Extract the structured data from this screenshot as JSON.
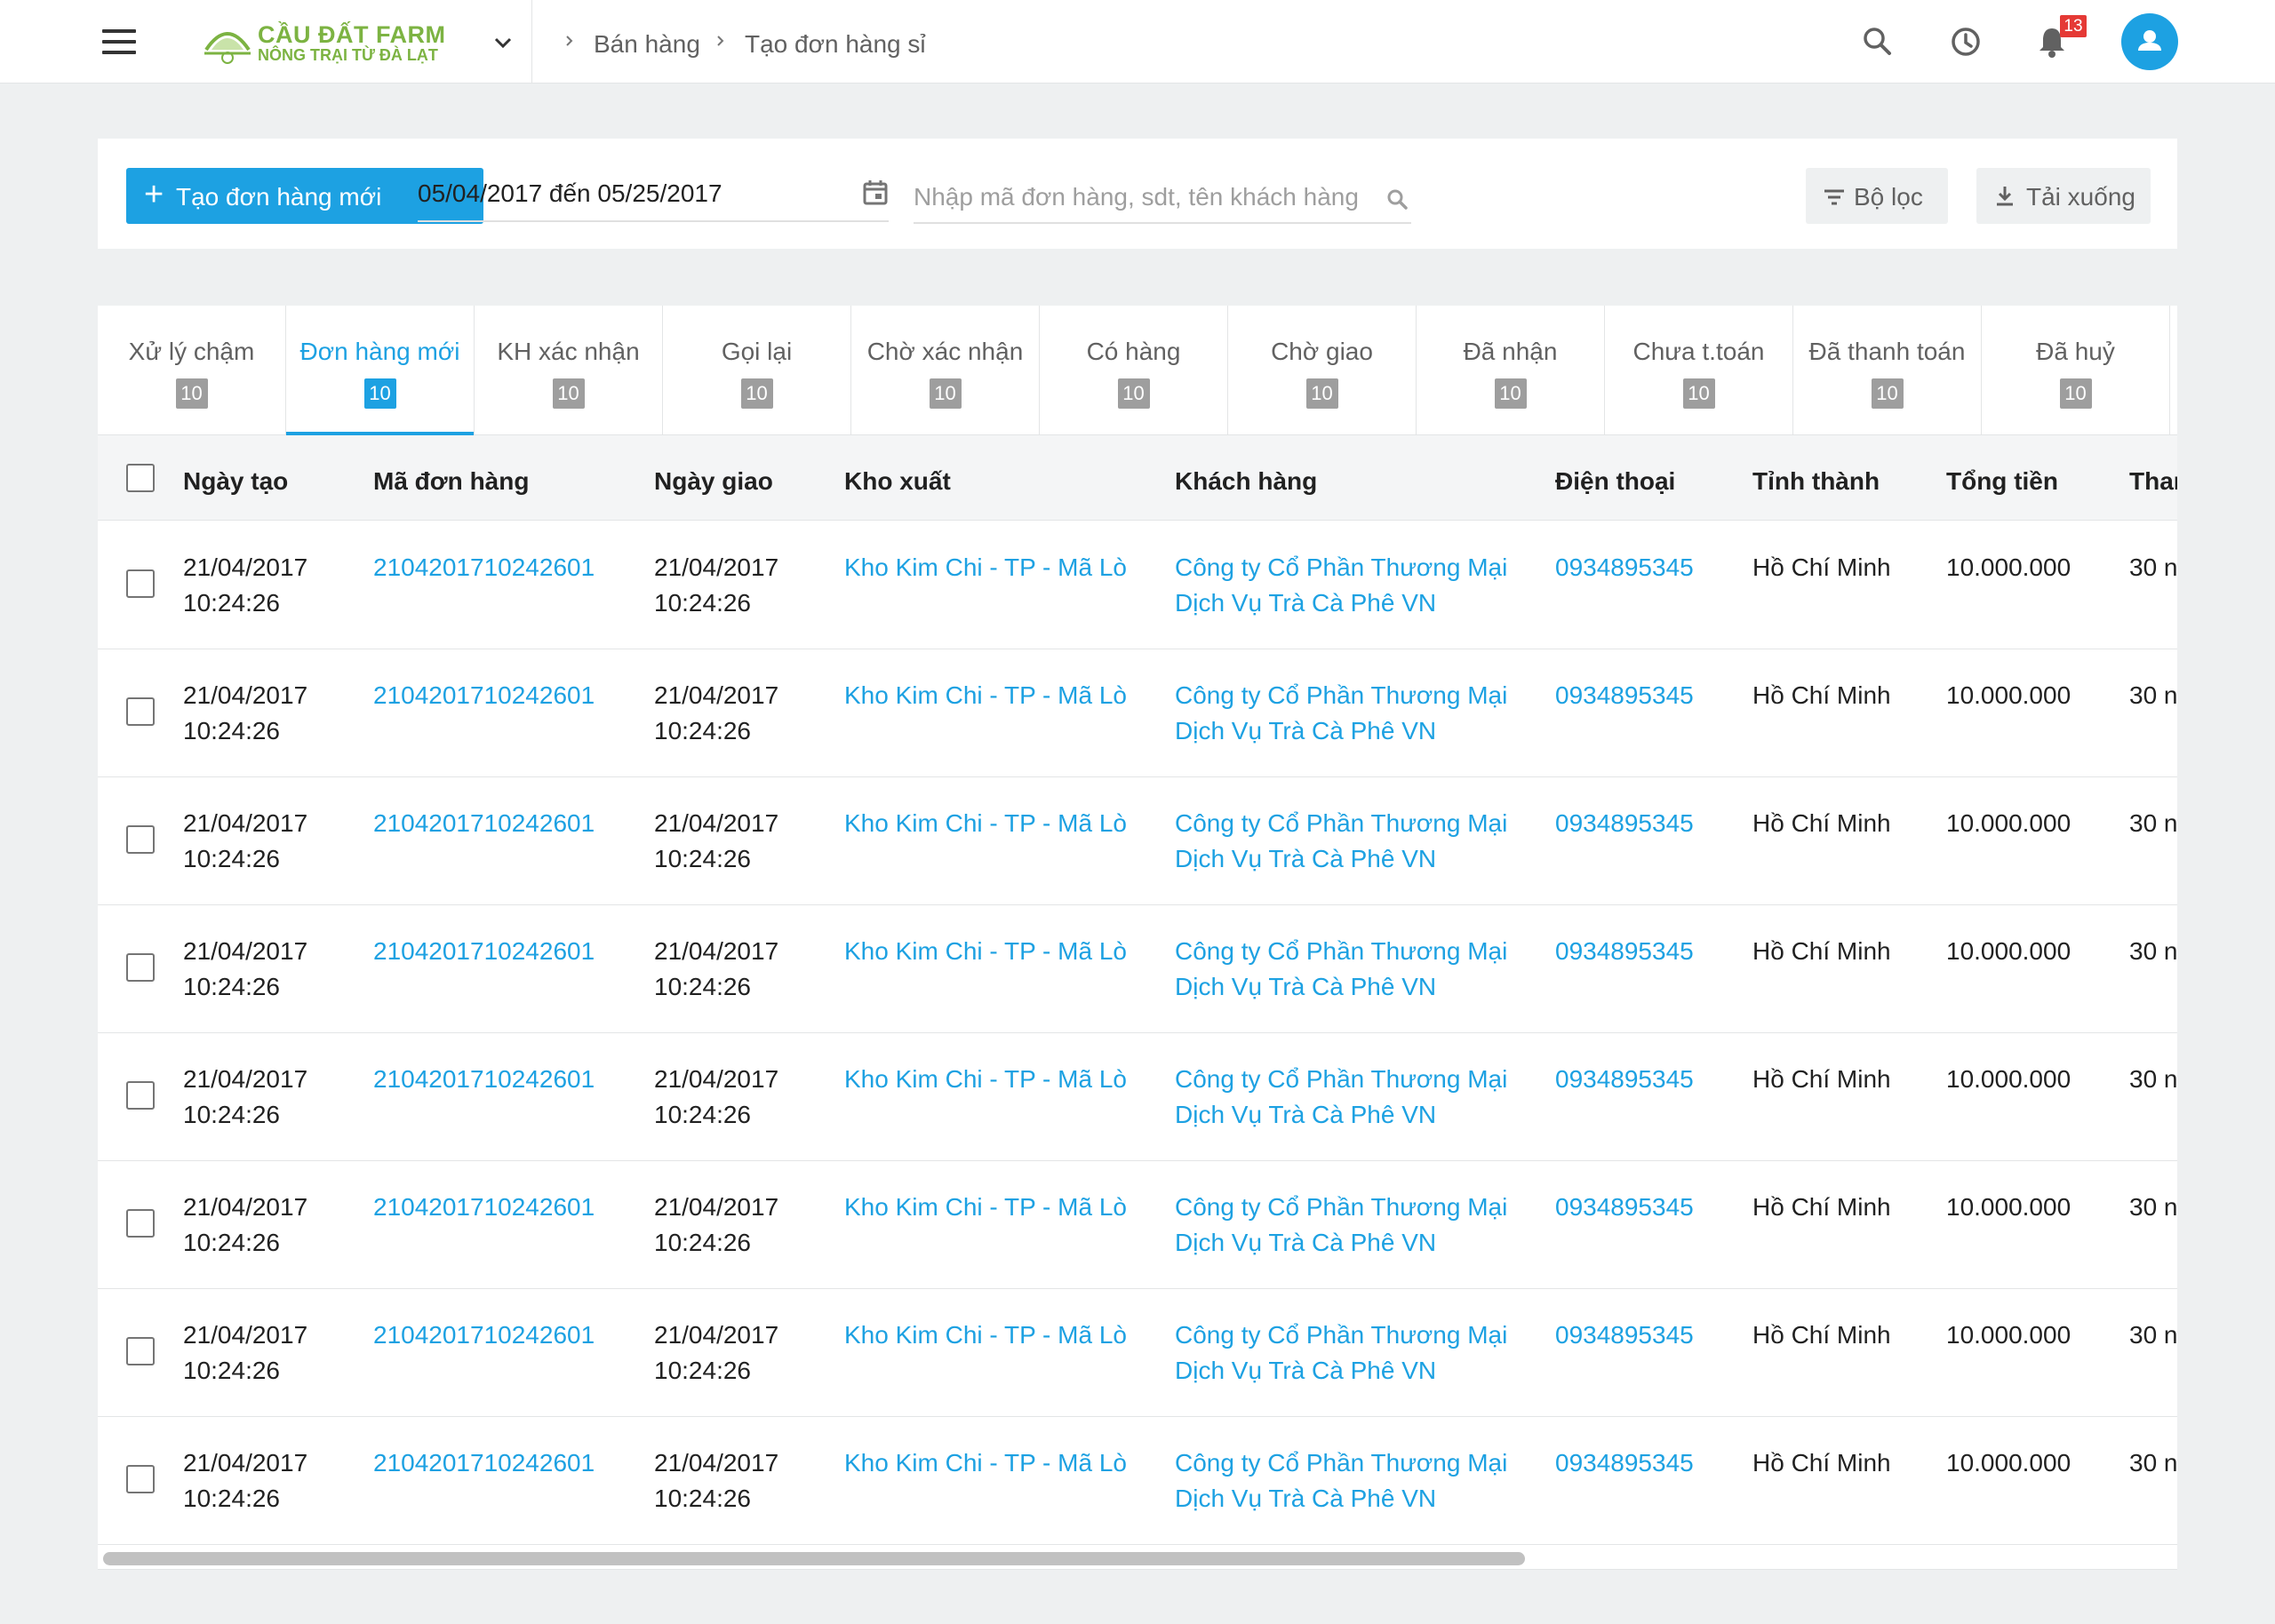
{
  "header": {
    "logo_brand": "CẦU ĐẤT FARM",
    "logo_tagline": "NÔNG TRẠI TỪ ĐÀ LẠT",
    "breadcrumbs": [
      "Bán hàng",
      "Tạo đơn hàng sỉ"
    ],
    "notification_count": "13",
    "icons": [
      "menu-icon",
      "chevron-down-icon",
      "search-icon",
      "history-icon",
      "bell-icon",
      "user-icon"
    ]
  },
  "toolbar": {
    "create_label": "Tạo đơn hàng mới",
    "date_range": "05/04/2017 đến 05/25/2017",
    "search_placeholder": "Nhập mã đơn hàng, sdt, tên khách hàng",
    "filter_label": "Bộ lọc",
    "download_label": "Tải xuống"
  },
  "tabs": [
    {
      "label": "Xử lý chậm",
      "count": "10"
    },
    {
      "label": "Đơn hàng mới",
      "count": "10"
    },
    {
      "label": "KH xác nhận",
      "count": "10"
    },
    {
      "label": "Gọi lại",
      "count": "10"
    },
    {
      "label": "Chờ xác nhận",
      "count": "10"
    },
    {
      "label": "Có hàng",
      "count": "10"
    },
    {
      "label": "Chờ giao",
      "count": "10"
    },
    {
      "label": "Đã nhận",
      "count": "10"
    },
    {
      "label": "Chưa t.toán",
      "count": "10"
    },
    {
      "label": "Đã thanh toán",
      "count": "10"
    },
    {
      "label": "Đã huỷ",
      "count": "10"
    }
  ],
  "active_tab": "Đơn hàng mới",
  "table": {
    "columns": [
      "Ngày tạo",
      "Mã đơn hàng",
      "Ngày giao",
      "Kho xuất",
      "Khách hàng",
      "Điện thoại",
      "Tỉnh thành",
      "Tổng tiền",
      "Thar"
    ],
    "rows": [
      {
        "created_date": "21/04/2017",
        "created_time": "10:24:26",
        "order_id": "2104201710242601",
        "delivery_date": "21/04/2017",
        "delivery_time": "10:24:26",
        "warehouse": "Kho Kim Chi - TP - Mã Lò",
        "customer_line1": "Công ty Cổ Phần Thương Mại",
        "customer_line2": "Dịch Vụ Trà Cà Phê VN",
        "phone": "0934895345",
        "province": "Hồ Chí Minh",
        "total": "10.000.000",
        "payment": "30 n"
      },
      {
        "created_date": "21/04/2017",
        "created_time": "10:24:26",
        "order_id": "2104201710242601",
        "delivery_date": "21/04/2017",
        "delivery_time": "10:24:26",
        "warehouse": "Kho Kim Chi - TP - Mã Lò",
        "customer_line1": "Công ty Cổ Phần Thương Mại",
        "customer_line2": "Dịch Vụ Trà Cà Phê VN",
        "phone": "0934895345",
        "province": "Hồ Chí Minh",
        "total": "10.000.000",
        "payment": "30 n"
      },
      {
        "created_date": "21/04/2017",
        "created_time": "10:24:26",
        "order_id": "2104201710242601",
        "delivery_date": "21/04/2017",
        "delivery_time": "10:24:26",
        "warehouse": "Kho Kim Chi - TP - Mã Lò",
        "customer_line1": "Công ty Cổ Phần Thương Mại",
        "customer_line2": "Dịch Vụ Trà Cà Phê VN",
        "phone": "0934895345",
        "province": "Hồ Chí Minh",
        "total": "10.000.000",
        "payment": "30 n"
      },
      {
        "created_date": "21/04/2017",
        "created_time": "10:24:26",
        "order_id": "2104201710242601",
        "delivery_date": "21/04/2017",
        "delivery_time": "10:24:26",
        "warehouse": "Kho Kim Chi - TP - Mã Lò",
        "customer_line1": "Công ty Cổ Phần Thương Mại",
        "customer_line2": "Dịch Vụ Trà Cà Phê VN",
        "phone": "0934895345",
        "province": "Hồ Chí Minh",
        "total": "10.000.000",
        "payment": "30 n"
      },
      {
        "created_date": "21/04/2017",
        "created_time": "10:24:26",
        "order_id": "2104201710242601",
        "delivery_date": "21/04/2017",
        "delivery_time": "10:24:26",
        "warehouse": "Kho Kim Chi - TP - Mã Lò",
        "customer_line1": "Công ty Cổ Phần Thương Mại",
        "customer_line2": "Dịch Vụ Trà Cà Phê VN",
        "phone": "0934895345",
        "province": "Hồ Chí Minh",
        "total": "10.000.000",
        "payment": "30 n"
      },
      {
        "created_date": "21/04/2017",
        "created_time": "10:24:26",
        "order_id": "2104201710242601",
        "delivery_date": "21/04/2017",
        "delivery_time": "10:24:26",
        "warehouse": "Kho Kim Chi - TP - Mã Lò",
        "customer_line1": "Công ty Cổ Phần Thương Mại",
        "customer_line2": "Dịch Vụ Trà Cà Phê VN",
        "phone": "0934895345",
        "province": "Hồ Chí Minh",
        "total": "10.000.000",
        "payment": "30 n"
      },
      {
        "created_date": "21/04/2017",
        "created_time": "10:24:26",
        "order_id": "2104201710242601",
        "delivery_date": "21/04/2017",
        "delivery_time": "10:24:26",
        "warehouse": "Kho Kim Chi - TP - Mã Lò",
        "customer_line1": "Công ty Cổ Phần Thương Mại",
        "customer_line2": "Dịch Vụ Trà Cà Phê VN",
        "phone": "0934895345",
        "province": "Hồ Chí Minh",
        "total": "10.000.000",
        "payment": "30 n"
      },
      {
        "created_date": "21/04/2017",
        "created_time": "10:24:26",
        "order_id": "2104201710242601",
        "delivery_date": "21/04/2017",
        "delivery_time": "10:24:26",
        "warehouse": "Kho Kim Chi - TP - Mã Lò",
        "customer_line1": "Công ty Cổ Phần Thương Mại",
        "customer_line2": "Dịch Vụ Trà Cà Phê VN",
        "phone": "0934895345",
        "province": "Hồ Chí Minh",
        "total": "10.000.000",
        "payment": "30 n"
      }
    ]
  },
  "colors": {
    "accent": "#1da1e2",
    "brand_green": "#7cb342",
    "badge_red": "#e53935",
    "background": "#eef0f1"
  }
}
